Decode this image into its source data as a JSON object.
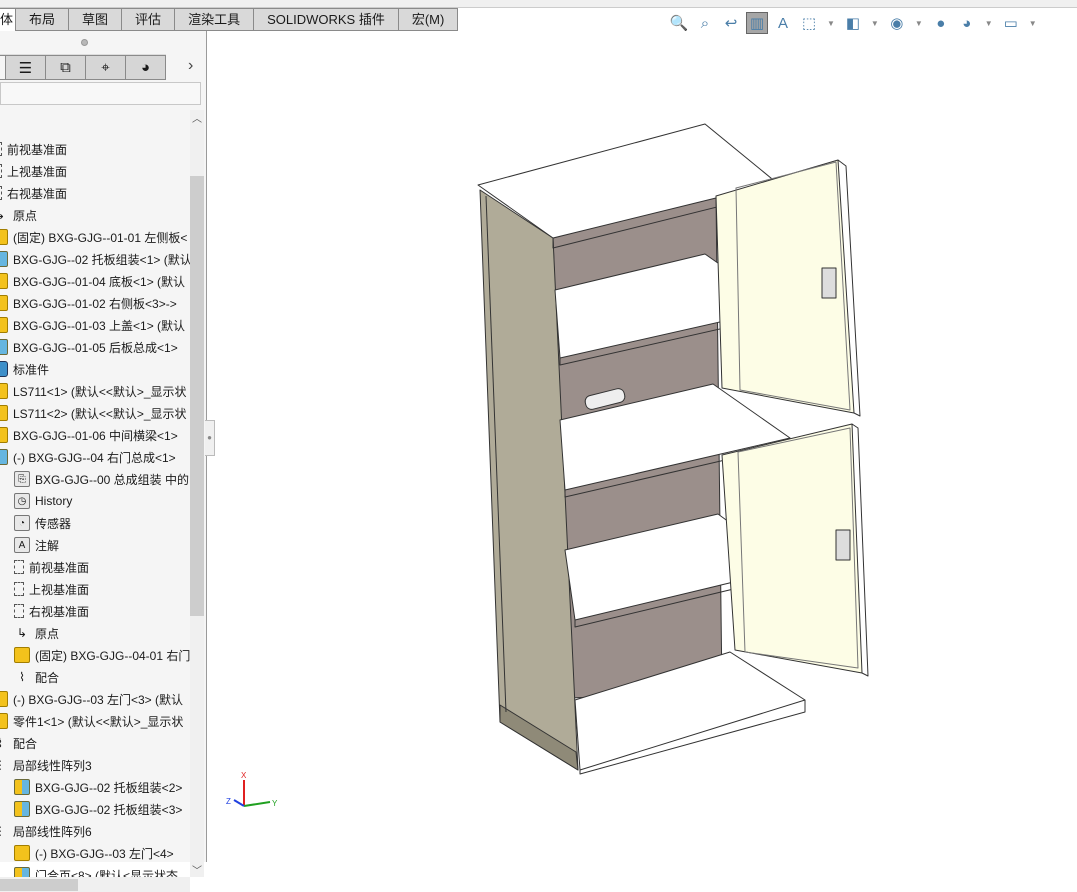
{
  "tabs": [
    {
      "label": "体",
      "active": true
    },
    {
      "label": "布局"
    },
    {
      "label": "草图"
    },
    {
      "label": "评估"
    },
    {
      "label": "渲染工具"
    },
    {
      "label": "SOLIDWORKS 插件"
    },
    {
      "label": "宏(M)"
    }
  ],
  "sidebar_tabs": [
    {
      "icon": "feature-manager-icon"
    },
    {
      "icon": "property-manager-icon",
      "glyph": "☰"
    },
    {
      "icon": "configuration-manager-icon",
      "glyph": "⧉"
    },
    {
      "icon": "dimxpert-icon",
      "glyph": "⌖"
    },
    {
      "icon": "display-manager-icon",
      "glyph": "◕"
    }
  ],
  "tree": [
    {
      "label": "前视基准面",
      "type": "plane",
      "level": 0
    },
    {
      "label": "上视基准面",
      "type": "plane",
      "level": 0
    },
    {
      "label": "右视基准面",
      "type": "plane",
      "level": 0
    },
    {
      "label": "原点",
      "type": "origin",
      "level": 0
    },
    {
      "label": "(固定) BXG-GJG--01-01 左侧板<",
      "type": "part",
      "level": 0
    },
    {
      "label": "BXG-GJG--02 托板组装<1> (默认",
      "type": "asm",
      "level": 0
    },
    {
      "label": "BXG-GJG--01-04 底板<1> (默认",
      "type": "part",
      "level": 0
    },
    {
      "label": "BXG-GJG--01-02 右侧板<3>->",
      "type": "part",
      "level": 0
    },
    {
      "label": "BXG-GJG--01-03 上盖<1> (默认",
      "type": "part",
      "level": 0
    },
    {
      "label": "BXG-GJG--01-05 后板总成<1>",
      "type": "asm",
      "level": 0
    },
    {
      "label": "标准件",
      "type": "folder-blue",
      "level": 0
    },
    {
      "label": "LS711<1> (默认<<默认>_显示状",
      "type": "part",
      "level": 0
    },
    {
      "label": "LS711<2> (默认<<默认>_显示状",
      "type": "part",
      "level": 0
    },
    {
      "label": "BXG-GJG--01-06 中间横梁<1>",
      "type": "part",
      "level": 0
    },
    {
      "label": "(-) BXG-GJG--04 右门总成<1>",
      "type": "asm",
      "level": 0
    },
    {
      "label": "BXG-GJG--00 总成组装 中的",
      "type": "folder",
      "level": 1
    },
    {
      "label": "History",
      "type": "history",
      "level": 1
    },
    {
      "label": "传感器",
      "type": "sensor",
      "level": 1
    },
    {
      "label": "注解",
      "type": "annotation",
      "level": 1
    },
    {
      "label": "前视基准面",
      "type": "plane",
      "level": 1
    },
    {
      "label": "上视基准面",
      "type": "plane",
      "level": 1
    },
    {
      "label": "右视基准面",
      "type": "plane",
      "level": 1
    },
    {
      "label": "原点",
      "type": "origin",
      "level": 1
    },
    {
      "label": "(固定) BXG-GJG--04-01 右门",
      "type": "part",
      "level": 1
    },
    {
      "label": "配合",
      "type": "mate",
      "level": 1
    },
    {
      "label": "(-) BXG-GJG--03 左门<3> (默认",
      "type": "part",
      "level": 0
    },
    {
      "label": "零件1<1> (默认<<默认>_显示状",
      "type": "part",
      "level": 0
    },
    {
      "label": "配合",
      "type": "mate",
      "level": 0
    },
    {
      "label": "局部线性阵列3",
      "type": "pattern",
      "level": 0
    },
    {
      "label": "BXG-GJG--02 托板组装<2>",
      "type": "asm",
      "level": 1
    },
    {
      "label": "BXG-GJG--02 托板组装<3>",
      "type": "asm",
      "level": 1
    },
    {
      "label": "局部线性阵列6",
      "type": "pattern",
      "level": 0
    },
    {
      "label": "(-) BXG-GJG--03 左门<4>",
      "type": "part",
      "level": 1
    },
    {
      "label": "门合页<8> (默认<显示状态",
      "type": "asm",
      "level": 1
    }
  ],
  "view_toolbar": [
    {
      "icon": "zoom-to-fit-icon",
      "glyph": "🔍"
    },
    {
      "icon": "zoom-to-area-icon",
      "glyph": "⌕"
    },
    {
      "icon": "previous-view-icon",
      "glyph": "↩"
    },
    {
      "icon": "section-view-icon",
      "glyph": "▥",
      "active": true
    },
    {
      "icon": "dynamic-annotation-view-icon",
      "glyph": "A"
    },
    {
      "icon": "view-orientation-icon",
      "glyph": "⬚",
      "dropdown": true
    },
    {
      "icon": "display-style-icon",
      "glyph": "◧",
      "dropdown": true
    },
    {
      "icon": "hide-show-items-icon",
      "glyph": "◉",
      "dropdown": true
    },
    {
      "icon": "edit-appearance-icon",
      "glyph": "●"
    },
    {
      "icon": "apply-scene-icon",
      "glyph": "◕",
      "dropdown": true
    },
    {
      "icon": "view-settings-icon",
      "glyph": "▭",
      "dropdown": true
    }
  ],
  "triad": {
    "x": "X",
    "y": "Y",
    "z": "Z"
  },
  "colors": {
    "side_panel": "#b0ab98",
    "back_panel": "#9b8f8b",
    "door": "#fdfde6",
    "shelf": "#ffffff",
    "x_axis": "#e02020",
    "y_axis": "#20a020",
    "z_axis": "#2040e0"
  }
}
